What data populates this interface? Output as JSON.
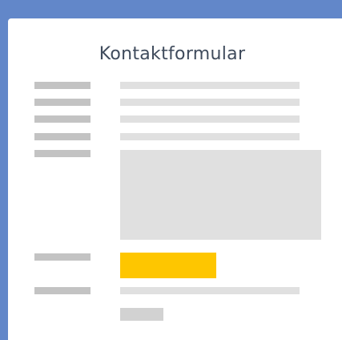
{
  "form": {
    "title": "Kontaktformular"
  },
  "colors": {
    "background": "#6287c9",
    "card": "#ffffff",
    "title_text": "#3f4b5c",
    "label_placeholder": "#c3c3c3",
    "field_placeholder": "#e0e0e0",
    "submit_button": "#fec600"
  }
}
